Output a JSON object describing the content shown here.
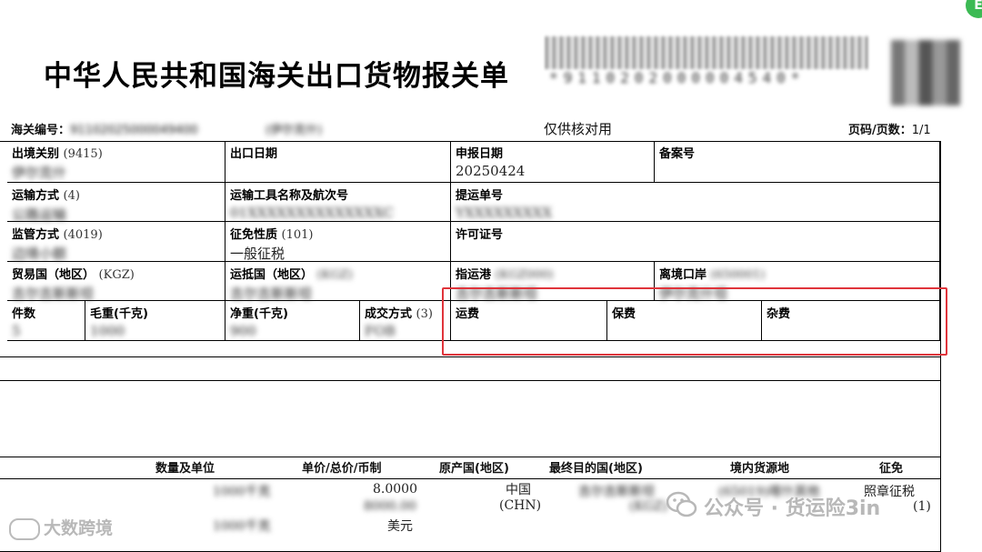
{
  "title": "中华人民共和国海关出口货物报关单",
  "barcode_text": "*9110202000004540*",
  "corner_badge": "E",
  "meta": {
    "customs_no_label": "海关编号：",
    "customs_no_value": "91102025000049400",
    "port_note": "(伊尔克什)",
    "verify_only": "仅供核对用",
    "page_label": "页码/页数：",
    "page_value": "1/1"
  },
  "fields": {
    "exit_customs": {
      "label": "出境关别",
      "code": "(9415)",
      "value": "伊尔克什"
    },
    "export_date": {
      "label": "出口日期",
      "code": "",
      "value": ""
    },
    "declare_date": {
      "label": "申报日期",
      "code": "",
      "value": "20250424"
    },
    "record_no": {
      "label": "备案号",
      "code": "",
      "value": ""
    },
    "transport_mode": {
      "label": "运输方式",
      "code": "(4)",
      "value": "公路运输"
    },
    "vehicle": {
      "label": "运输工具名称及航次号",
      "code": "",
      "value": "01XXXXXXXXXXXXXXC"
    },
    "bill_no": {
      "label": "提运单号",
      "code": "",
      "value": "YXXXXXXXXX"
    },
    "supervision": {
      "label": "监管方式",
      "code": "(4019)",
      "value": "边境小额"
    },
    "tax_nature": {
      "label": "征免性质",
      "code": "(101)",
      "value": "一般征税"
    },
    "license_no": {
      "label": "许可证号",
      "code": "",
      "value": ""
    },
    "trade_country": {
      "label": "贸易国（地区）",
      "code": "(KGZ)",
      "value": "吉尔吉斯斯坦"
    },
    "arrival_country": {
      "label": "运抵国（地区）",
      "code": "(KGZ)",
      "value": "吉尔吉斯斯坦"
    },
    "dest_port": {
      "label": "指运港",
      "code": "(KGZ000)",
      "value": "吉尔吉斯斯坦"
    },
    "exit_port": {
      "label": "离境口岸",
      "code": "(650001)",
      "value": "伊尔克什坦"
    },
    "packages": {
      "label": "件数",
      "code": "",
      "value": "5"
    },
    "gross_weight": {
      "label": "毛重(千克)",
      "code": "",
      "value": "1000"
    },
    "net_weight": {
      "label": "净重(千克)",
      "code": "",
      "value": "900"
    },
    "deal_mode": {
      "label": "成交方式",
      "code": "(3)",
      "value": "FOB"
    },
    "freight": {
      "label": "运费",
      "code": "",
      "value": ""
    },
    "insurance": {
      "label": "保费",
      "code": "",
      "value": ""
    },
    "misc_fee": {
      "label": "杂费",
      "code": "",
      "value": ""
    }
  },
  "goods_headers": {
    "qty_unit": "数量及单位",
    "price": "单价/总价/币制",
    "origin": "原产国(地区)",
    "final_dest": "最终目的国(地区)",
    "source": "境内货源地",
    "levy": "征免"
  },
  "goods_row": {
    "qty1": "1000千克",
    "qty2": "1000千克",
    "unit_price": "8.0000",
    "total_price": "8000.00",
    "currency": "美元",
    "origin_name": "中国",
    "origin_code": "(CHN)",
    "dest_name": "吉尔吉斯斯坦",
    "dest_code": "(KGZ)",
    "source_place": "(65019)喀什其他",
    "levy_mode": "照章征税",
    "levy_code": "(1)"
  },
  "watermarks": {
    "left": "大数跨境",
    "right_prefix": "公众号 · 货运险",
    "right_suffix": "3in"
  },
  "colors": {
    "highlight_box": "#e0343b",
    "watermark": "#b8b8b8"
  }
}
